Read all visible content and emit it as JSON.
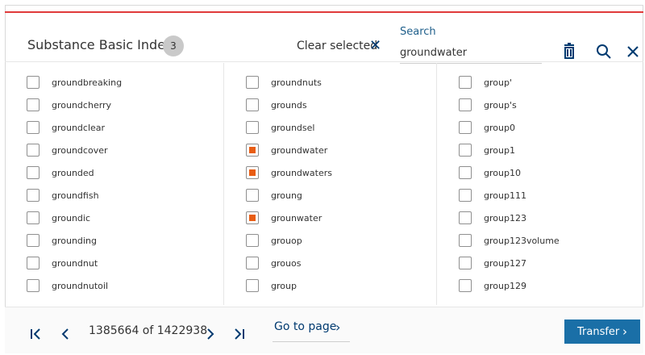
{
  "header": {
    "title": "Substance Basic Index",
    "count": "3",
    "clear_selected": "Clear selected",
    "search_label": "Search",
    "search_value": "groundwater"
  },
  "icons": {
    "clear": "close-icon",
    "trash": "trash-icon",
    "search": "search-icon",
    "close": "close-icon",
    "first_page": "first-page-icon",
    "prev_page": "chevron-left-icon",
    "next_page": "chevron-right-icon",
    "last_page": "last-page-icon",
    "goto_arrow": "chevron-right-icon",
    "transfer_arrow": "chevron-right-icon"
  },
  "columns": [
    [
      {
        "label": "groundbreaking",
        "checked": false
      },
      {
        "label": "groundcherry",
        "checked": false
      },
      {
        "label": "groundclear",
        "checked": false
      },
      {
        "label": "groundcover",
        "checked": false
      },
      {
        "label": "grounded",
        "checked": false
      },
      {
        "label": "groundfish",
        "checked": false
      },
      {
        "label": "groundic",
        "checked": false
      },
      {
        "label": "grounding",
        "checked": false
      },
      {
        "label": "groundnut",
        "checked": false
      },
      {
        "label": "groundnutoil",
        "checked": false
      }
    ],
    [
      {
        "label": "groundnuts",
        "checked": false
      },
      {
        "label": "grounds",
        "checked": false
      },
      {
        "label": "groundsel",
        "checked": false
      },
      {
        "label": "groundwater",
        "checked": true
      },
      {
        "label": "groundwaters",
        "checked": true
      },
      {
        "label": "groung",
        "checked": false
      },
      {
        "label": "grounwater",
        "checked": true
      },
      {
        "label": "grouop",
        "checked": false
      },
      {
        "label": "grouos",
        "checked": false
      },
      {
        "label": "group",
        "checked": false
      }
    ],
    [
      {
        "label": "group'",
        "checked": false
      },
      {
        "label": "group's",
        "checked": false
      },
      {
        "label": "group0",
        "checked": false
      },
      {
        "label": "group1",
        "checked": false
      },
      {
        "label": "group10",
        "checked": false
      },
      {
        "label": "group111",
        "checked": false
      },
      {
        "label": "group123",
        "checked": false
      },
      {
        "label": "group123volume",
        "checked": false
      },
      {
        "label": "group127",
        "checked": false
      },
      {
        "label": "group129",
        "checked": false
      }
    ]
  ],
  "footer": {
    "page_status": "1385664 of 1422938",
    "goto_label": "Go to page",
    "transfer_label": "Transfer"
  },
  "colors": {
    "accent_line": "#e03a3a",
    "checkbox_checked": "#e85d14",
    "primary": "#1a6fa7",
    "icon_navy": "#003a70"
  }
}
